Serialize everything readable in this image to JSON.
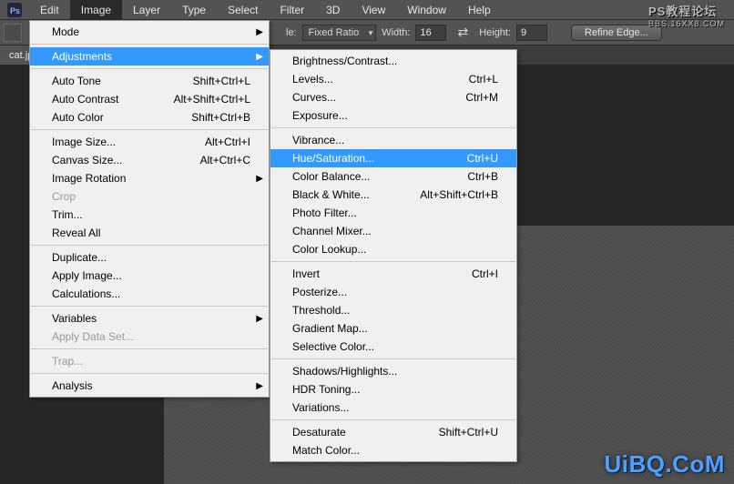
{
  "menubar": {
    "items": [
      "Edit",
      "Image",
      "Layer",
      "Type",
      "Select",
      "Filter",
      "3D",
      "View",
      "Window",
      "Help"
    ],
    "active_index": 1
  },
  "optionbar": {
    "style_label": "le:",
    "style_value": "Fixed Ratio",
    "width_label": "Width:",
    "width_value": "16",
    "height_label": "Height:",
    "height_value": "9",
    "refine_label": "Refine Edge..."
  },
  "tab": {
    "label": "cat.jp"
  },
  "image_menu": [
    {
      "label": "Mode",
      "type": "submenu"
    },
    {
      "type": "sep"
    },
    {
      "label": "Adjustments",
      "type": "submenu",
      "highlight": true
    },
    {
      "type": "sep"
    },
    {
      "label": "Auto Tone",
      "shortcut": "Shift+Ctrl+L"
    },
    {
      "label": "Auto Contrast",
      "shortcut": "Alt+Shift+Ctrl+L"
    },
    {
      "label": "Auto Color",
      "shortcut": "Shift+Ctrl+B"
    },
    {
      "type": "sep"
    },
    {
      "label": "Image Size...",
      "shortcut": "Alt+Ctrl+I"
    },
    {
      "label": "Canvas Size...",
      "shortcut": "Alt+Ctrl+C"
    },
    {
      "label": "Image Rotation",
      "type": "submenu"
    },
    {
      "label": "Crop",
      "disabled": true
    },
    {
      "label": "Trim..."
    },
    {
      "label": "Reveal All"
    },
    {
      "type": "sep"
    },
    {
      "label": "Duplicate..."
    },
    {
      "label": "Apply Image..."
    },
    {
      "label": "Calculations..."
    },
    {
      "type": "sep"
    },
    {
      "label": "Variables",
      "type": "submenu"
    },
    {
      "label": "Apply Data Set...",
      "disabled": true
    },
    {
      "type": "sep"
    },
    {
      "label": "Trap...",
      "disabled": true
    },
    {
      "type": "sep"
    },
    {
      "label": "Analysis",
      "type": "submenu"
    }
  ],
  "adjust_menu": [
    {
      "label": "Brightness/Contrast..."
    },
    {
      "label": "Levels...",
      "shortcut": "Ctrl+L"
    },
    {
      "label": "Curves...",
      "shortcut": "Ctrl+M"
    },
    {
      "label": "Exposure..."
    },
    {
      "type": "sep"
    },
    {
      "label": "Vibrance..."
    },
    {
      "label": "Hue/Saturation...",
      "shortcut": "Ctrl+U",
      "highlight": true
    },
    {
      "label": "Color Balance...",
      "shortcut": "Ctrl+B"
    },
    {
      "label": "Black & White...",
      "shortcut": "Alt+Shift+Ctrl+B"
    },
    {
      "label": "Photo Filter..."
    },
    {
      "label": "Channel Mixer..."
    },
    {
      "label": "Color Lookup..."
    },
    {
      "type": "sep"
    },
    {
      "label": "Invert",
      "shortcut": "Ctrl+I"
    },
    {
      "label": "Posterize..."
    },
    {
      "label": "Threshold..."
    },
    {
      "label": "Gradient Map..."
    },
    {
      "label": "Selective Color..."
    },
    {
      "type": "sep"
    },
    {
      "label": "Shadows/Highlights..."
    },
    {
      "label": "HDR Toning..."
    },
    {
      "label": "Variations..."
    },
    {
      "type": "sep"
    },
    {
      "label": "Desaturate",
      "shortcut": "Shift+Ctrl+U"
    },
    {
      "label": "Match Color..."
    }
  ],
  "watermarks": {
    "top_line1": "PS教程论坛",
    "top_line2": "BBS.16XX8.COM",
    "bottom": "UiBQ.CoM"
  },
  "icons": {
    "ps_logo": "Ps"
  }
}
